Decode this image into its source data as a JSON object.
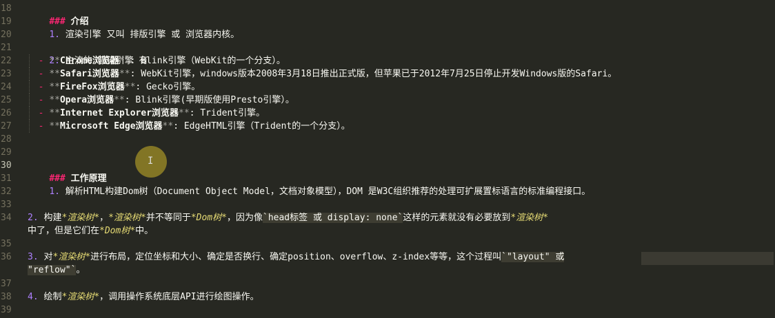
{
  "line_numbers": [
    "18",
    "19",
    "20",
    "21",
    "22",
    "23",
    "24",
    "25",
    "26",
    "27",
    "28",
    "29",
    "30",
    "31",
    "32",
    "33",
    "34",
    "35",
    "36",
    "37",
    "38",
    "39"
  ],
  "active_line": "30",
  "lines": {
    "l18": {
      "hash": "###",
      "text": "介绍"
    },
    "l19": {
      "num": "1.",
      "text": "渲染引擎 又叫 排版引擎 或 浏览器内核。"
    },
    "l21": {
      "num": "2.",
      "text": "主流的 渲染引擎 有"
    },
    "l22": {
      "bullet": "-",
      "open": "**",
      "bold": "Chrome浏览器",
      "close": "**",
      "rest": ": Blink引擎（WebKit的一个分支）。"
    },
    "l23": {
      "bullet": "-",
      "open": "**",
      "bold": "Safari浏览器",
      "close": "**",
      "rest": ": WebKit引擎，windows版本2008年3月18日推出正式版，但苹果已于2012年7月25日停止开发Windows版的Safari。"
    },
    "l24": {
      "bullet": "-",
      "open": "**",
      "bold": "FireFox浏览器",
      "close": "**",
      "rest": ": Gecko引擎。"
    },
    "l25": {
      "bullet": "-",
      "open": "**",
      "bold": "Opera浏览器",
      "close": "**",
      "rest": ": Blink引擎(早期版使用Presto引擎）。"
    },
    "l26": {
      "bullet": "-",
      "open": "**",
      "bold": "Internet Explorer浏览器",
      "close": "**",
      "rest": ": Trident引擎。"
    },
    "l27": {
      "bullet": "-",
      "open": "**",
      "bold": "Microsoft Edge浏览器",
      "close": "**",
      "rest": ": EdgeHTML引擎（Trident的一个分支）。"
    },
    "l30": {
      "hash": "###",
      "text": "工作原理"
    },
    "l31": {
      "num": "1.",
      "text": "解析HTML构建Dom树（Document Object Model，文档对象模型），DOM 是W3C组织推荐的处理可扩展置标语言的标准编程接口。"
    },
    "l34": {
      "num": "2.",
      "a": "构建",
      "b": "*渲染树*",
      "c": "，",
      "d": "*渲染树*",
      "e": "并不等同于",
      "f": "*Dom树*",
      "g": "，因为像",
      "code": "`head标签 或 display: none`",
      "h": "这样的元素就没有必要放到",
      "i": "*渲染树*"
    },
    "l35": {
      "a": "中了，但是它们在",
      "b": "*Dom树*",
      "c": "中。"
    },
    "l36": {
      "num": "3.",
      "a": "对",
      "b": "*渲染树*",
      "c": "进行布局，定位坐标和大小、确定是否换行、确定position、overflow、z-index等等，这个过程叫",
      "code": "`\"layout\" 或"
    },
    "l36b": {
      "code": "\"reflow\"`",
      "end": "。"
    },
    "l38": {
      "num": "4.",
      "a": "绘制",
      "b": "*渲染树*",
      "c": "，调用操作系统底层API进行绘图操作。"
    }
  },
  "colors": {
    "background": "#272822",
    "hash": "#f92672",
    "number": "#ae81ff",
    "italic": "#e6db74",
    "line_number": "#75715e"
  },
  "cursor": {
    "icon": "text-cursor-icon",
    "glyph": "I"
  }
}
